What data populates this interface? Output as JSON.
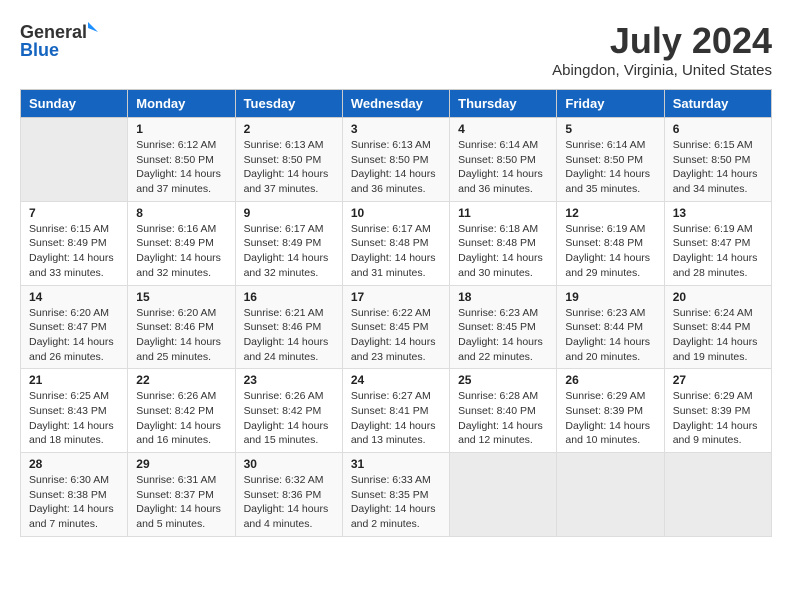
{
  "header": {
    "logo_general": "General",
    "logo_blue": "Blue",
    "month_year": "July 2024",
    "location": "Abingdon, Virginia, United States"
  },
  "weekdays": [
    "Sunday",
    "Monday",
    "Tuesday",
    "Wednesday",
    "Thursday",
    "Friday",
    "Saturday"
  ],
  "weeks": [
    [
      {
        "day": "",
        "empty": true
      },
      {
        "day": "1",
        "sunrise": "6:12 AM",
        "sunset": "8:50 PM",
        "daylight": "14 hours and 37 minutes."
      },
      {
        "day": "2",
        "sunrise": "6:13 AM",
        "sunset": "8:50 PM",
        "daylight": "14 hours and 37 minutes."
      },
      {
        "day": "3",
        "sunrise": "6:13 AM",
        "sunset": "8:50 PM",
        "daylight": "14 hours and 36 minutes."
      },
      {
        "day": "4",
        "sunrise": "6:14 AM",
        "sunset": "8:50 PM",
        "daylight": "14 hours and 36 minutes."
      },
      {
        "day": "5",
        "sunrise": "6:14 AM",
        "sunset": "8:50 PM",
        "daylight": "14 hours and 35 minutes."
      },
      {
        "day": "6",
        "sunrise": "6:15 AM",
        "sunset": "8:50 PM",
        "daylight": "14 hours and 34 minutes."
      }
    ],
    [
      {
        "day": "7",
        "sunrise": "6:15 AM",
        "sunset": "8:49 PM",
        "daylight": "14 hours and 33 minutes."
      },
      {
        "day": "8",
        "sunrise": "6:16 AM",
        "sunset": "8:49 PM",
        "daylight": "14 hours and 32 minutes."
      },
      {
        "day": "9",
        "sunrise": "6:17 AM",
        "sunset": "8:49 PM",
        "daylight": "14 hours and 32 minutes."
      },
      {
        "day": "10",
        "sunrise": "6:17 AM",
        "sunset": "8:48 PM",
        "daylight": "14 hours and 31 minutes."
      },
      {
        "day": "11",
        "sunrise": "6:18 AM",
        "sunset": "8:48 PM",
        "daylight": "14 hours and 30 minutes."
      },
      {
        "day": "12",
        "sunrise": "6:19 AM",
        "sunset": "8:48 PM",
        "daylight": "14 hours and 29 minutes."
      },
      {
        "day": "13",
        "sunrise": "6:19 AM",
        "sunset": "8:47 PM",
        "daylight": "14 hours and 28 minutes."
      }
    ],
    [
      {
        "day": "14",
        "sunrise": "6:20 AM",
        "sunset": "8:47 PM",
        "daylight": "14 hours and 26 minutes."
      },
      {
        "day": "15",
        "sunrise": "6:20 AM",
        "sunset": "8:46 PM",
        "daylight": "14 hours and 25 minutes."
      },
      {
        "day": "16",
        "sunrise": "6:21 AM",
        "sunset": "8:46 PM",
        "daylight": "14 hours and 24 minutes."
      },
      {
        "day": "17",
        "sunrise": "6:22 AM",
        "sunset": "8:45 PM",
        "daylight": "14 hours and 23 minutes."
      },
      {
        "day": "18",
        "sunrise": "6:23 AM",
        "sunset": "8:45 PM",
        "daylight": "14 hours and 22 minutes."
      },
      {
        "day": "19",
        "sunrise": "6:23 AM",
        "sunset": "8:44 PM",
        "daylight": "14 hours and 20 minutes."
      },
      {
        "day": "20",
        "sunrise": "6:24 AM",
        "sunset": "8:44 PM",
        "daylight": "14 hours and 19 minutes."
      }
    ],
    [
      {
        "day": "21",
        "sunrise": "6:25 AM",
        "sunset": "8:43 PM",
        "daylight": "14 hours and 18 minutes."
      },
      {
        "day": "22",
        "sunrise": "6:26 AM",
        "sunset": "8:42 PM",
        "daylight": "14 hours and 16 minutes."
      },
      {
        "day": "23",
        "sunrise": "6:26 AM",
        "sunset": "8:42 PM",
        "daylight": "14 hours and 15 minutes."
      },
      {
        "day": "24",
        "sunrise": "6:27 AM",
        "sunset": "8:41 PM",
        "daylight": "14 hours and 13 minutes."
      },
      {
        "day": "25",
        "sunrise": "6:28 AM",
        "sunset": "8:40 PM",
        "daylight": "14 hours and 12 minutes."
      },
      {
        "day": "26",
        "sunrise": "6:29 AM",
        "sunset": "8:39 PM",
        "daylight": "14 hours and 10 minutes."
      },
      {
        "day": "27",
        "sunrise": "6:29 AM",
        "sunset": "8:39 PM",
        "daylight": "14 hours and 9 minutes."
      }
    ],
    [
      {
        "day": "28",
        "sunrise": "6:30 AM",
        "sunset": "8:38 PM",
        "daylight": "14 hours and 7 minutes."
      },
      {
        "day": "29",
        "sunrise": "6:31 AM",
        "sunset": "8:37 PM",
        "daylight": "14 hours and 5 minutes."
      },
      {
        "day": "30",
        "sunrise": "6:32 AM",
        "sunset": "8:36 PM",
        "daylight": "14 hours and 4 minutes."
      },
      {
        "day": "31",
        "sunrise": "6:33 AM",
        "sunset": "8:35 PM",
        "daylight": "14 hours and 2 minutes."
      },
      {
        "day": "",
        "empty": true
      },
      {
        "day": "",
        "empty": true
      },
      {
        "day": "",
        "empty": true
      }
    ]
  ]
}
